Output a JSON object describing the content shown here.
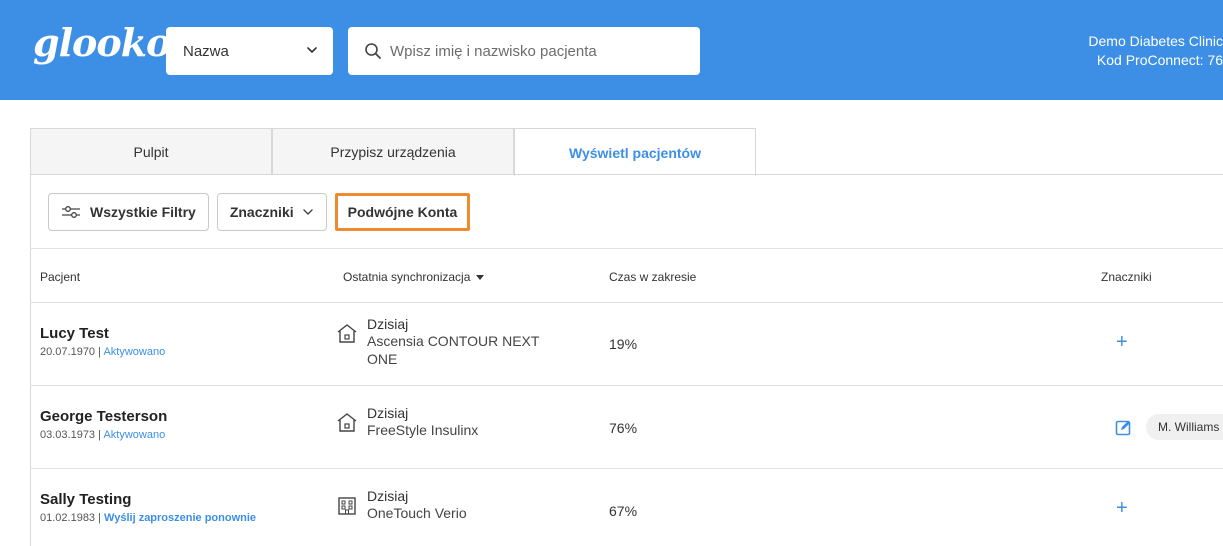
{
  "header": {
    "logo": "glooko",
    "search_mode": "Nazwa",
    "search_placeholder": "Wpisz imię i nazwisko pacjenta",
    "user_name": "Demo Diabetes Clinic",
    "proconnect_code": "Kod ProConnect: 76"
  },
  "tabs": [
    {
      "label": "Pulpit"
    },
    {
      "label": "Przypisz urządzenia"
    },
    {
      "label": "Wyświetl pacjentów"
    }
  ],
  "filters": {
    "all_filters": "Wszystkie Filtry",
    "tags": "Znaczniki",
    "duplicate_accounts": "Podwójne Konta"
  },
  "table": {
    "headers": {
      "patient": "Pacjent",
      "last_sync": "Ostatnia synchronizacja",
      "time_in_range": "Czas w zakresie",
      "tags": "Znaczniki"
    },
    "rows": [
      {
        "name": "Lucy Test",
        "dob": "20.07.1970",
        "status": "Aktywowano",
        "sync_when": "Dzisiaj",
        "device": "Ascensia CONTOUR NEXT ONE",
        "tir": "19%"
      },
      {
        "name": "George Testerson",
        "dob": "03.03.1973",
        "status": "Aktywowano",
        "sync_when": "Dzisiaj",
        "device": "FreeStyle Insulinx",
        "tir": "76%",
        "tag": "M. Williams"
      },
      {
        "name": "Sally Testing",
        "dob": "01.02.1983",
        "status": "Wyślij zaproszenie ponownie",
        "sync_when": "Dzisiaj",
        "device": "OneTouch Verio",
        "tir": "67%"
      }
    ]
  },
  "colors": {
    "brand_blue": "#3d8fe6",
    "highlight_orange": "#f08a2e"
  }
}
